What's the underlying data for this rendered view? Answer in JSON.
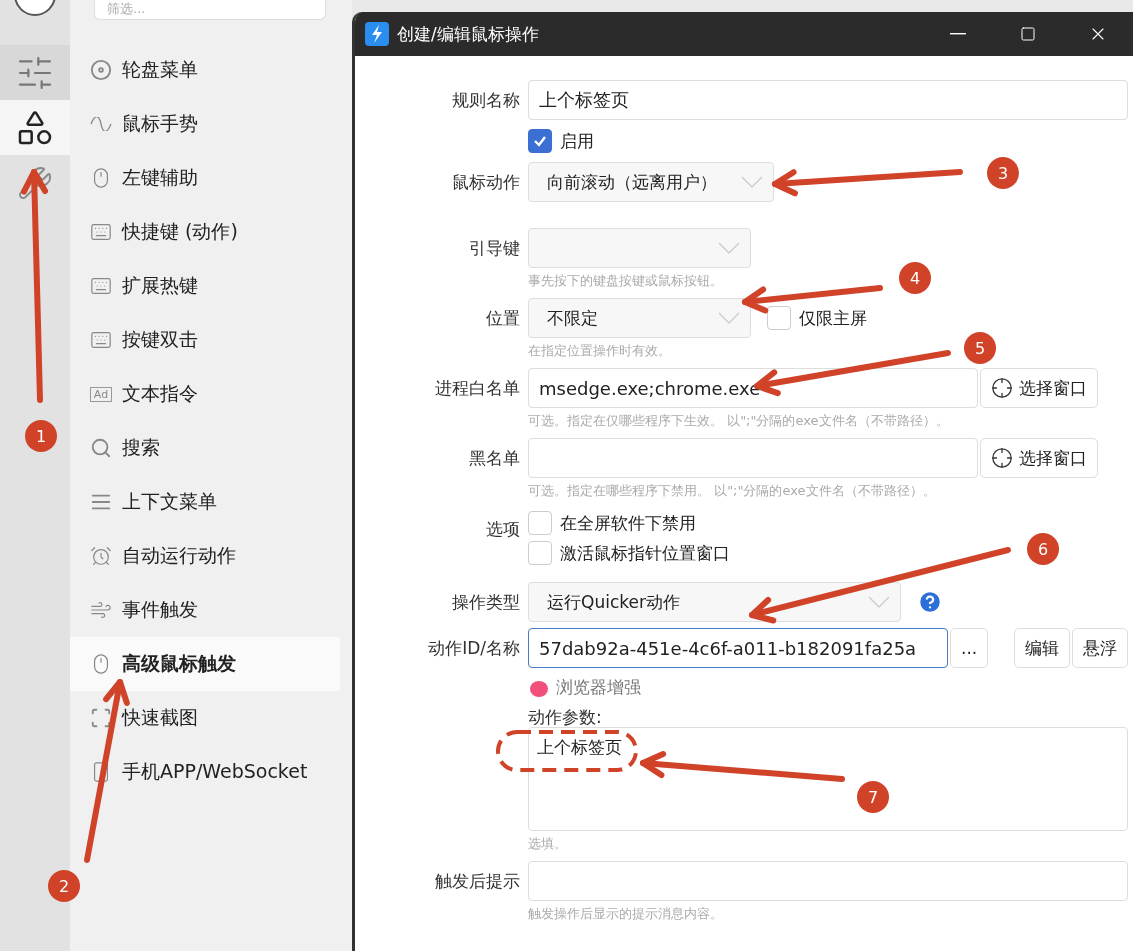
{
  "rail": {
    "items": [
      {
        "selected": false
      },
      {
        "selected": true
      },
      {
        "selected": false
      }
    ]
  },
  "sidebar": {
    "search": {
      "placeholder": "筛选..."
    },
    "items": [
      {
        "label": "轮盘菜单",
        "selected": false
      },
      {
        "label": "鼠标手势",
        "selected": false
      },
      {
        "label": "左键辅助",
        "selected": false
      },
      {
        "label": "快捷键 (动作)",
        "selected": false
      },
      {
        "label": "扩展热键",
        "selected": false
      },
      {
        "label": "按键双击",
        "selected": false
      },
      {
        "icon_text": "Ad",
        "label": "文本指令",
        "selected": false
      },
      {
        "label": "搜索",
        "selected": false
      },
      {
        "label": "上下文菜单",
        "selected": false
      },
      {
        "label": "自动运行动作",
        "selected": false
      },
      {
        "label": "事件触发",
        "selected": false
      },
      {
        "label": "高级鼠标触发",
        "selected": true
      },
      {
        "label": "快速截图",
        "selected": false
      },
      {
        "label": "手机APP/WebSocket",
        "selected": false
      }
    ]
  },
  "dialog": {
    "title": "创建/编辑鼠标操作",
    "rows": [
      {
        "kind": "text",
        "label": "规则名称",
        "value": "上个标签页"
      },
      {
        "kind": "check",
        "label": "启用",
        "checked": true
      },
      {
        "kind": "select",
        "label": "鼠标动作",
        "value": "向前滚动（远离用户）"
      },
      {
        "kind": "select",
        "label": "引导键",
        "hint": "事先按下的键盘按键或鼠标按钮。"
      },
      {
        "kind": "select",
        "label": "位置",
        "value": "不限定",
        "extra_check": {
          "label": "仅限主屏",
          "checked": false
        },
        "hint": "在指定位置操作时有效。"
      },
      {
        "kind": "text",
        "label": "进程白名单",
        "value": "msedge.exe;chrome.exe",
        "button": "选择窗口",
        "hint": "可选。指定在仅哪些程序下生效。 以\";\"分隔的exe文件名（不带路径）。"
      },
      {
        "kind": "text",
        "label": "黑名单",
        "button": "选择窗口",
        "hint": "可选。指定在哪些程序下禁用。 以\";\"分隔的exe文件名（不带路径）。"
      },
      {
        "kind": "checks",
        "label": "选项",
        "items": [
          {
            "label": "在全屏软件下禁用",
            "checked": false
          },
          {
            "label": "激活鼠标指针位置窗口",
            "checked": false
          }
        ]
      },
      {
        "kind": "select",
        "label": "操作类型",
        "value": "运行Quicker动作",
        "help": true
      },
      {
        "kind": "action",
        "label": "动作ID/名称",
        "value": "57dab92a-451e-4c6f-a011-b182091fa25a",
        "focused": true,
        "buttons": [
          "...",
          "编辑",
          "悬浮"
        ],
        "tag": "浏览器增强"
      },
      {
        "kind": "area",
        "label": "动作参数:",
        "value": "上个标签页",
        "hint": "选填。"
      },
      {
        "kind": "text",
        "label": "触发后提示",
        "hint": "触发操作后显示的提示消息内容。"
      }
    ]
  },
  "annotations": [
    {
      "kind": "callout",
      "label": "1"
    },
    {
      "kind": "callout",
      "label": "2"
    },
    {
      "kind": "callout",
      "label": "3"
    },
    {
      "kind": "callout",
      "label": "4"
    },
    {
      "kind": "callout",
      "label": "5"
    },
    {
      "kind": "callout",
      "label": "6"
    },
    {
      "kind": "callout",
      "label": "7"
    },
    {
      "kind": "outline"
    }
  ]
}
